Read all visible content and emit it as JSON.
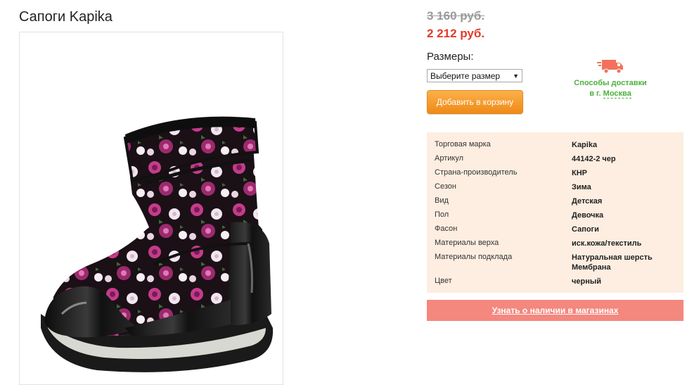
{
  "product": {
    "title": "Сапоги Kapika",
    "image_alt": "boot-photo"
  },
  "price": {
    "old": "3 160 руб.",
    "new": "2 212 руб."
  },
  "sizes": {
    "label": "Размеры:",
    "select_value": "Выберите размер"
  },
  "cart": {
    "button_label": "Добавить в корзину"
  },
  "delivery": {
    "line1": "Способы доставки",
    "prefix": "в г. ",
    "city": "Москва",
    "icon": "truck-icon"
  },
  "specs": [
    {
      "key": "Торговая марка",
      "value": "Kapika"
    },
    {
      "key": "Артикул",
      "value": "44142-2 чер"
    },
    {
      "key": "Страна-производитель",
      "value": "КНР"
    },
    {
      "key": "Сезон",
      "value": "Зима"
    },
    {
      "key": "Вид",
      "value": "Детская"
    },
    {
      "key": "Пол",
      "value": "Девочка"
    },
    {
      "key": "Фасон",
      "value": "Сапоги"
    },
    {
      "key": "Материалы верха",
      "value": "иск.кожа/текстиль"
    },
    {
      "key": "Материалы подклада",
      "value": "Натуральная шерсть",
      "value2": "Мембрана"
    },
    {
      "key": "Цвет",
      "value": "черный"
    }
  ],
  "availability": {
    "label": "Узнать о наличии в магазинах"
  },
  "colors": {
    "price_red": "#e23a2a",
    "button_orange": "#f59a2a",
    "delivery_green": "#4caf3c",
    "specs_bg": "#fdeee1",
    "availability_bg": "#f4877e"
  }
}
